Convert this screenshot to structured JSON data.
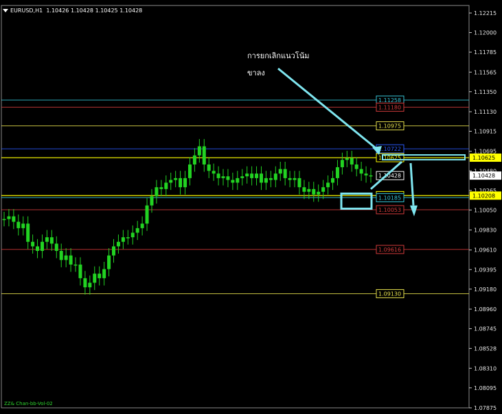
{
  "header": {
    "symbol": "EURUSD,H1",
    "ohlc": "1.10426 1.10428 1.10425 1.10428"
  },
  "annotation": {
    "line1": "การยกเลิกแนวโน้ม",
    "line2": "ขาลง"
  },
  "footer": {
    "indicator_label": "ZZ& Chan-bb-Vol-02"
  },
  "colors": {
    "background": "#000000",
    "grid": "#1f1f1f",
    "candle": "#22d322",
    "annotation_arrow": "#7fe6f0"
  },
  "chart_data": {
    "type": "line",
    "title": "EURUSD,H1",
    "yaxis": {
      "ticks": [
        "1.12215",
        "1.12000",
        "1.11785",
        "1.11565",
        "1.11350",
        "1.11130",
        "1.10915",
        "1.10695",
        "1.10480",
        "1.10265",
        "1.10050",
        "1.09830",
        "1.09610",
        "1.09395",
        "1.09180",
        "1.08960",
        "1.08745",
        "1.08528",
        "1.08310",
        "1.08095",
        "1.07875"
      ],
      "ylim": [
        1.0785,
        1.1225
      ]
    },
    "price_labels": [
      {
        "value": 1.11258,
        "text": "1.11258",
        "color": "#36c4d6"
      },
      {
        "value": 1.1118,
        "text": "1.11180",
        "color": "#d43b3b"
      },
      {
        "value": 1.10975,
        "text": "1.10975",
        "color": "#e6e04d"
      },
      {
        "value": 1.10722,
        "text": "1.10722",
        "color": "#2a5cff"
      },
      {
        "value": 1.10625,
        "text": "1.10625",
        "color": "#ffff00"
      },
      {
        "value": 1.10428,
        "text": "1.10428",
        "color": "#ffffff"
      },
      {
        "value": 1.10208,
        "text": "1.10208",
        "color": "#ffff00"
      },
      {
        "value": 1.10185,
        "text": "1.10185",
        "color": "#36c4d6"
      },
      {
        "value": 1.10053,
        "text": "1.10053",
        "color": "#d43b3b"
      },
      {
        "value": 1.09616,
        "text": "1.09616",
        "color": "#d43b3b"
      },
      {
        "value": 1.0913,
        "text": "1.09130",
        "color": "#e6e04d"
      }
    ],
    "series": [
      {
        "name": "EURUSD",
        "values": [
          1.0995,
          1.0998,
          1.0992,
          1.0985,
          1.099,
          1.097,
          1.0965,
          1.096,
          1.097,
          1.0975,
          1.0968,
          1.096,
          1.095,
          1.0955,
          1.0945,
          1.0945,
          1.093,
          1.092,
          1.0925,
          1.0935,
          1.093,
          1.094,
          1.0955,
          1.0965,
          1.097,
          1.0975,
          1.0975,
          1.098,
          1.0985,
          1.099,
          1.101,
          1.102,
          1.103,
          1.1028,
          1.1035,
          1.1038,
          1.104,
          1.103,
          1.104,
          1.1055,
          1.1065,
          1.1075,
          1.1055,
          1.1048,
          1.1045,
          1.104,
          1.1042,
          1.1038,
          1.1035,
          1.104,
          1.1042,
          1.1045,
          1.104,
          1.1045,
          1.1035,
          1.104,
          1.1038,
          1.1045,
          1.105,
          1.104,
          1.1038,
          1.104,
          1.103,
          1.1025,
          1.1028,
          1.1022,
          1.1025,
          1.103,
          1.1035,
          1.104,
          1.1052,
          1.106,
          1.1062,
          1.1055,
          1.105,
          1.1045,
          1.1043,
          1.1043
        ]
      }
    ],
    "grid": true
  }
}
